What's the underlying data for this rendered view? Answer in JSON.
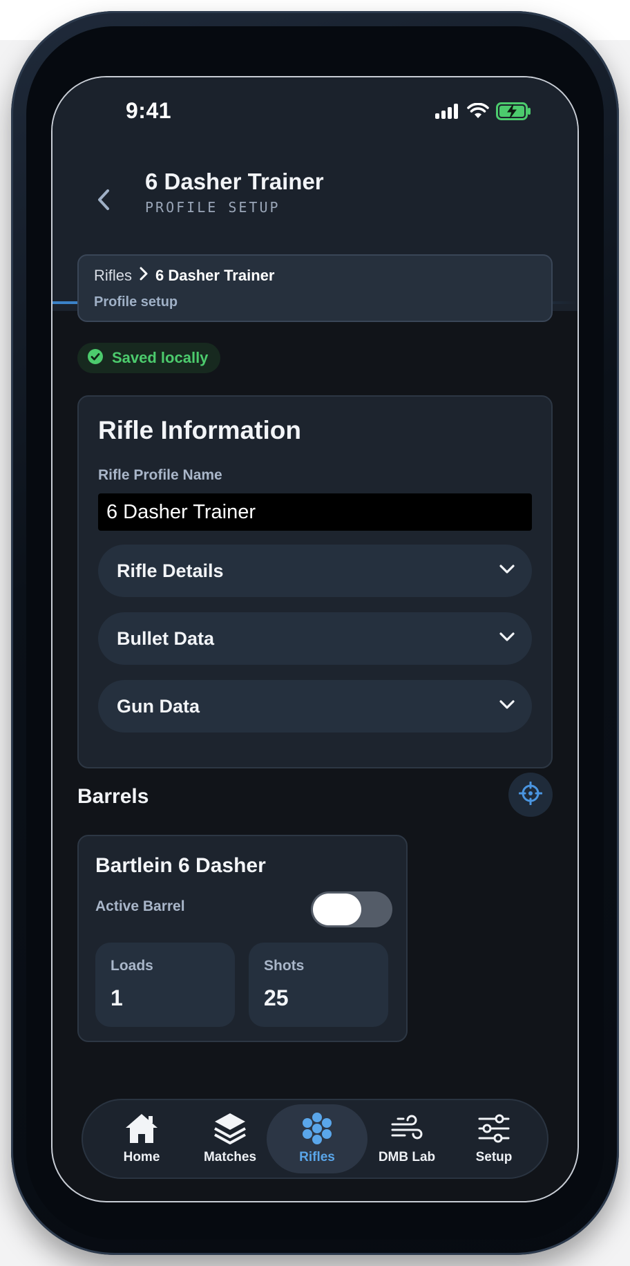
{
  "status_bar": {
    "time": "9:41",
    "icons": [
      "signal-icon",
      "wifi-icon",
      "battery-charging-icon"
    ]
  },
  "header": {
    "title": "6 Dasher Trainer",
    "subtitle": "PROFILE SETUP",
    "back_icon": "chevron-left-icon"
  },
  "breadcrumb": {
    "root": "Rifles",
    "current": "6 Dasher Trainer",
    "subtitle": "Profile setup"
  },
  "save_status": {
    "label": "Saved locally",
    "color": "#4ccb6d"
  },
  "rifle_info": {
    "title": "Rifle Information",
    "name_label": "Rifle Profile Name",
    "name_value": "6 Dasher Trainer",
    "sections": [
      {
        "label": "Rifle Details"
      },
      {
        "label": "Bullet Data"
      },
      {
        "label": "Gun Data"
      }
    ]
  },
  "barrels": {
    "title": "Barrels",
    "action_icon": "crosshair-icon",
    "items": [
      {
        "name": "Bartlein 6 Dasher",
        "active_label": "Active Barrel",
        "active": false,
        "loads_label": "Loads",
        "loads_value": "1",
        "shots_label": "Shots",
        "shots_value": "25"
      }
    ]
  },
  "tab_bar": {
    "accent": "#5aa6ea",
    "tabs": [
      {
        "label": "Home",
        "icon": "home-icon"
      },
      {
        "label": "Matches",
        "icon": "layers-icon"
      },
      {
        "label": "Rifles",
        "icon": "rifles-cluster-icon",
        "selected": true
      },
      {
        "label": "DMB Lab",
        "icon": "wind-icon"
      },
      {
        "label": "Setup",
        "icon": "sliders-icon"
      }
    ]
  }
}
